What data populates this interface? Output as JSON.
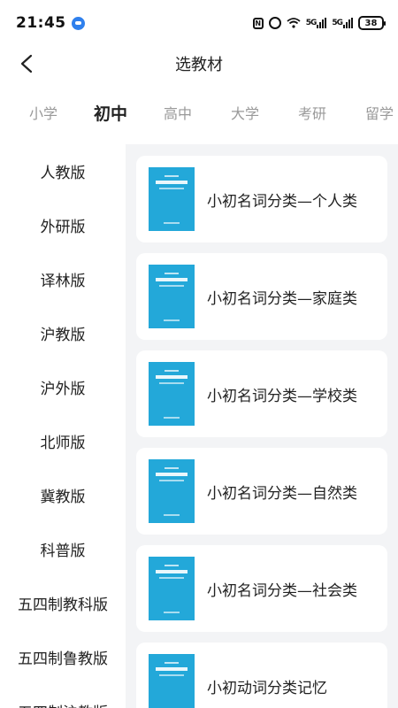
{
  "status_bar": {
    "time": "21:45",
    "battery": "38"
  },
  "header": {
    "title": "选教材"
  },
  "level_tabs": [
    {
      "label": "小学",
      "active": false
    },
    {
      "label": "初中",
      "active": true
    },
    {
      "label": "高中",
      "active": false
    },
    {
      "label": "大学",
      "active": false
    },
    {
      "label": "考研",
      "active": false
    },
    {
      "label": "留学",
      "active": false
    }
  ],
  "editions": [
    {
      "label": "人教版"
    },
    {
      "label": "外研版"
    },
    {
      "label": "译林版"
    },
    {
      "label": "沪教版"
    },
    {
      "label": "沪外版"
    },
    {
      "label": "北师版"
    },
    {
      "label": "冀教版"
    },
    {
      "label": "科普版"
    },
    {
      "label": "五四制教科版"
    },
    {
      "label": "五四制鲁教版"
    },
    {
      "label": "五四制沪教版"
    }
  ],
  "books": [
    {
      "title": "小初名词分类—个人类"
    },
    {
      "title": "小初名词分类—家庭类"
    },
    {
      "title": "小初名词分类—学校类"
    },
    {
      "title": "小初名词分类—自然类"
    },
    {
      "title": "小初名词分类—社会类"
    },
    {
      "title": "小初动词分类记忆"
    }
  ],
  "colors": {
    "cover": "#23a8d9",
    "content_bg": "#f3f4f6",
    "inactive_tab": "#999999"
  }
}
